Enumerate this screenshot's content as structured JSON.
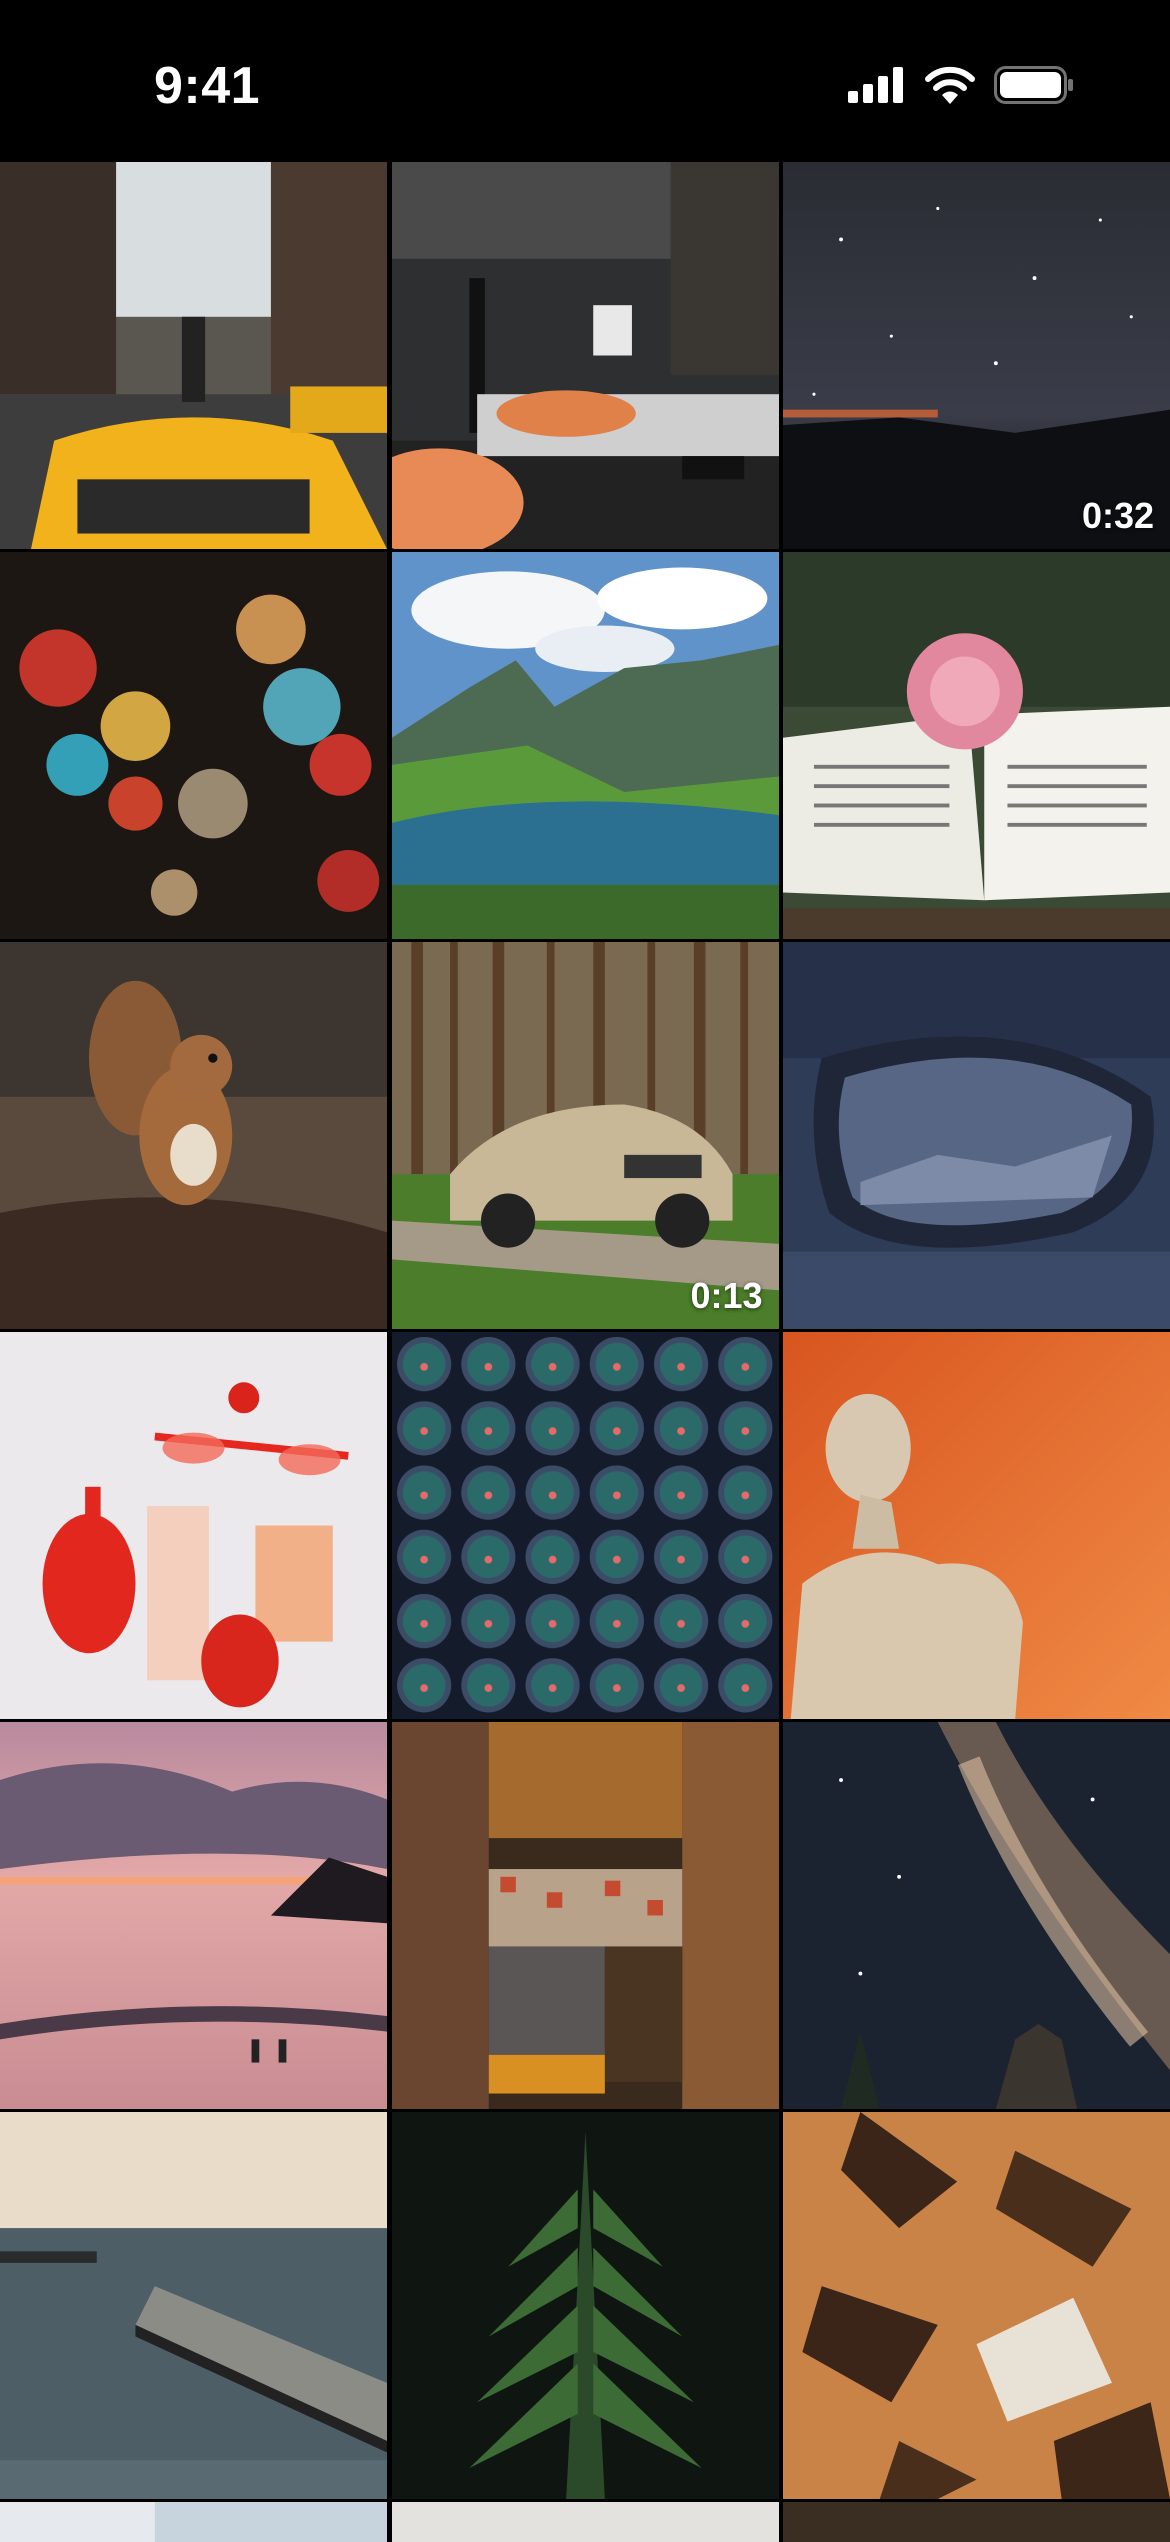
{
  "status_bar": {
    "time": "9:41",
    "icons": [
      "cellular-signal-icon",
      "wifi-icon",
      "battery-icon"
    ]
  },
  "grid": {
    "tiles": [
      {
        "subject": "yellow-taxi-city-street",
        "duration": ""
      },
      {
        "subject": "dark-modern-bedroom",
        "duration": ""
      },
      {
        "subject": "night-starry-sky-bridge",
        "duration": "0:32"
      },
      {
        "subject": "rain-drops-bokeh-lights",
        "duration": ""
      },
      {
        "subject": "mountain-lake-landscape",
        "duration": ""
      },
      {
        "subject": "pink-peony-on-open-book",
        "duration": ""
      },
      {
        "subject": "red-squirrel-in-leaves",
        "duration": ""
      },
      {
        "subject": "suv-in-pine-forest",
        "duration": "0:13"
      },
      {
        "subject": "car-side-mirror-reflection",
        "duration": ""
      },
      {
        "subject": "red-bottles-and-sunglasses",
        "duration": ""
      },
      {
        "subject": "teal-circle-pattern",
        "duration": ""
      },
      {
        "subject": "venus-statue-orange-background",
        "duration": ""
      },
      {
        "subject": "sunset-beach-surfers",
        "duration": ""
      },
      {
        "subject": "retro-kitchen-interior",
        "duration": ""
      },
      {
        "subject": "milky-way-over-church",
        "duration": ""
      },
      {
        "subject": "pier-over-sea",
        "duration": ""
      },
      {
        "subject": "green-fern-leaf",
        "duration": ""
      },
      {
        "subject": "peeling-orange-paint",
        "duration": ""
      }
    ]
  }
}
